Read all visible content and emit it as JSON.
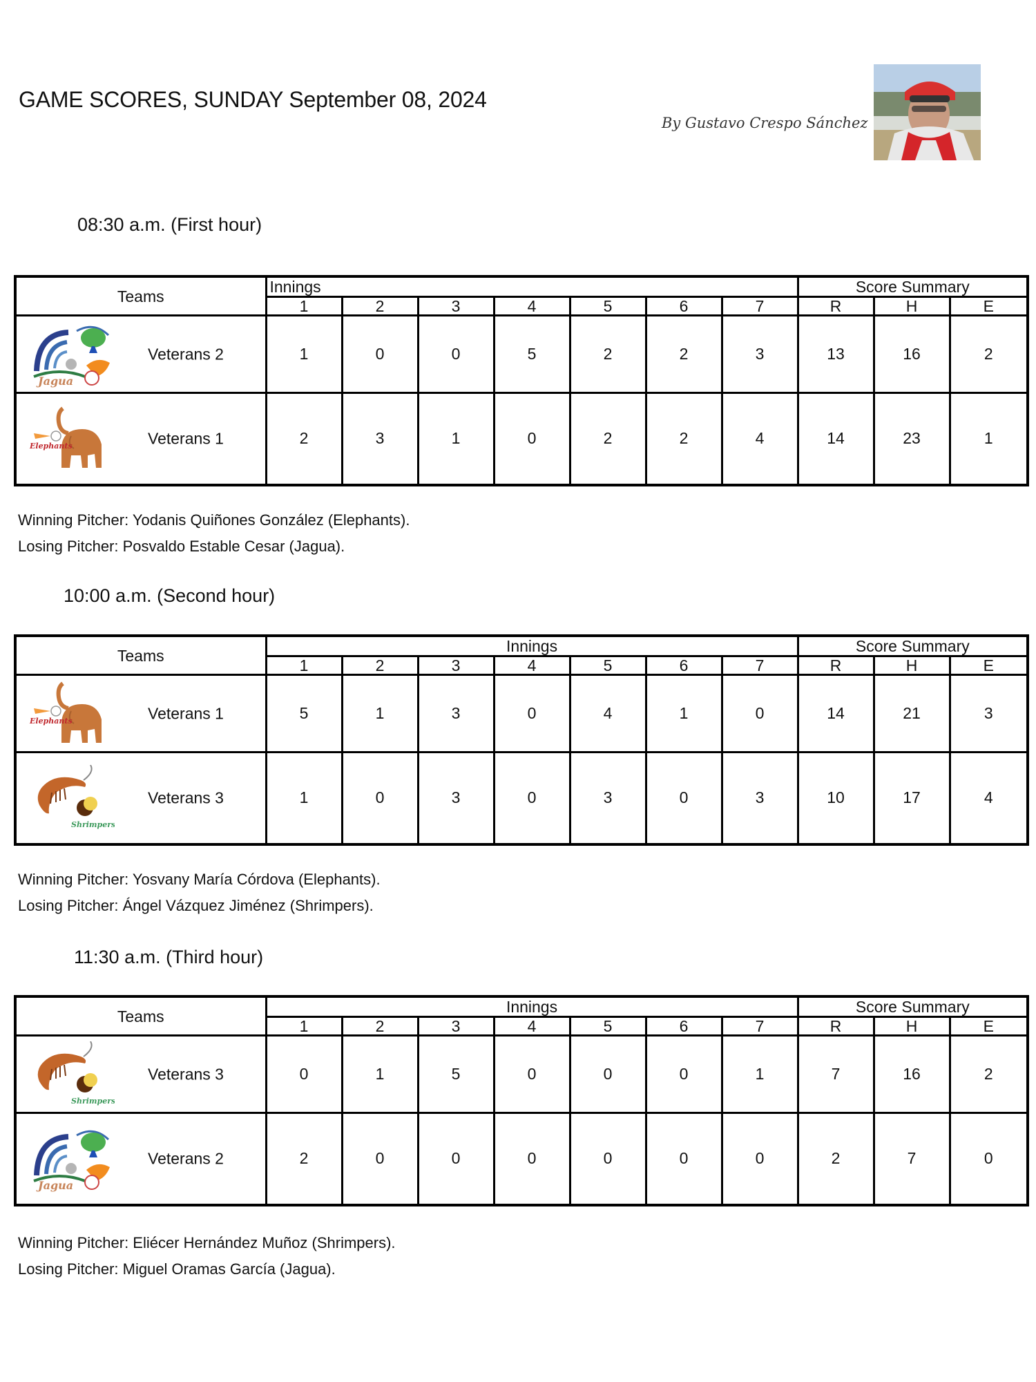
{
  "header": {
    "title": "GAME SCORES, SUNDAY September 08, 2024",
    "byline": "By Gustavo Crespo Sánchez",
    "author_photo": "author-photo"
  },
  "table_labels": {
    "teams": "Teams",
    "innings": "Innings",
    "score_summary": "Score Summary",
    "inning_numbers": [
      "1",
      "2",
      "3",
      "4",
      "5",
      "6",
      "7"
    ],
    "summary_cols": [
      "R",
      "H",
      "E"
    ]
  },
  "games": [
    {
      "heading": "08:30 a.m. (First hour)",
      "rows": [
        {
          "logo": "jagua-logo",
          "team": "Veterans 2",
          "innings": [
            "1",
            "0",
            "0",
            "5",
            "2",
            "2",
            "3"
          ],
          "R": "13",
          "H": "16",
          "E": "2"
        },
        {
          "logo": "elephants-logo",
          "team": "Veterans 1",
          "innings": [
            "2",
            "3",
            "1",
            "0",
            "2",
            "2",
            "4"
          ],
          "R": "14",
          "H": "23",
          "E": "1"
        }
      ],
      "winning_pitcher": "Winning Pitcher: Yodanis Quiñones González (Elephants).",
      "losing_pitcher": "Losing Pitcher: Posvaldo Estable Cesar (Jagua)."
    },
    {
      "heading": "10:00 a.m. (Second hour)",
      "rows": [
        {
          "logo": "elephants-logo",
          "team": "Veterans 1",
          "innings": [
            "5",
            "1",
            "3",
            "0",
            "4",
            "1",
            "0"
          ],
          "R": "14",
          "H": "21",
          "E": "3"
        },
        {
          "logo": "shrimpers-logo",
          "team": "Veterans 3",
          "innings": [
            "1",
            "0",
            "3",
            "0",
            "3",
            "0",
            "3"
          ],
          "R": "10",
          "H": "17",
          "E": "4"
        }
      ],
      "winning_pitcher": "Winning Pitcher: Yosvany María Córdova (Elephants).",
      "losing_pitcher": "Losing Pitcher: Ángel Vázquez Jiménez (Shrimpers)."
    },
    {
      "heading": "11:30 a.m. (Third hour)",
      "rows": [
        {
          "logo": "shrimpers-logo",
          "team": "Veterans 3",
          "innings": [
            "0",
            "1",
            "5",
            "0",
            "0",
            "0",
            "1"
          ],
          "R": "7",
          "H": "16",
          "E": "2"
        },
        {
          "logo": "jagua-logo",
          "team": "Veterans 2",
          "innings": [
            "2",
            "0",
            "0",
            "0",
            "0",
            "0",
            "0"
          ],
          "R": "2",
          "H": "7",
          "E": "0"
        }
      ],
      "winning_pitcher": "Winning Pitcher: Eliécer Hernández Muñoz (Shrimpers).",
      "losing_pitcher": "Losing Pitcher: Miguel Oramas García (Jagua)."
    }
  ],
  "logo_text": {
    "jagua": "Jagua",
    "elephants": "Elephants",
    "shrimpers": "Shrimpers"
  }
}
